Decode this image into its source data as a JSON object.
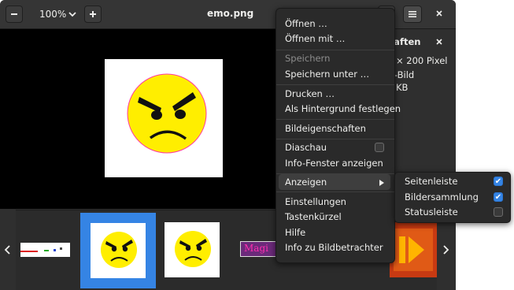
{
  "header": {
    "zoom_out_icon": "minus-icon",
    "zoom_level": "100%",
    "zoom_in_icon": "plus-icon",
    "title": "emo.png",
    "menu_icon": "hamburger-icon",
    "close_icon": "close-icon"
  },
  "properties": {
    "title": "haften",
    "close_icon": "close-icon",
    "size": "0 × 200 Pixel",
    "type": "G-Bild",
    "filesize": "4 KB"
  },
  "gallery": {
    "prev_icon": "chevron-left-icon",
    "next_icon": "chevron-right-icon",
    "thumb_text": "Magi"
  },
  "menu": {
    "items": [
      {
        "label": "Öffnen …",
        "enabled": true
      },
      {
        "label": "Öffnen mit …",
        "enabled": true
      },
      {
        "label": "Speichern",
        "enabled": false
      },
      {
        "label": "Speichern unter …",
        "enabled": true
      },
      {
        "label": "Drucken …",
        "enabled": true
      },
      {
        "label": "Als Hintergrund festlegen",
        "enabled": true
      },
      {
        "label": "Bildeigenschaften",
        "enabled": true
      },
      {
        "label": "Diaschau",
        "enabled": true
      },
      {
        "label": "Info-Fenster anzeigen",
        "enabled": true
      },
      {
        "label": "Anzeigen",
        "enabled": true
      },
      {
        "label": "Einstellungen",
        "enabled": true
      },
      {
        "label": "Tastenkürzel",
        "enabled": true
      },
      {
        "label": "Hilfe",
        "enabled": true
      },
      {
        "label": "Info zu Bildbetrachter",
        "enabled": true
      }
    ]
  },
  "submenu": {
    "items": [
      {
        "label": "Seitenleiste",
        "checked": true
      },
      {
        "label": "Bildersammlung",
        "checked": true
      },
      {
        "label": "Statusleiste",
        "checked": false
      }
    ]
  },
  "colors": {
    "accent": "#3584e4",
    "emoji_face": "#ffee00"
  }
}
